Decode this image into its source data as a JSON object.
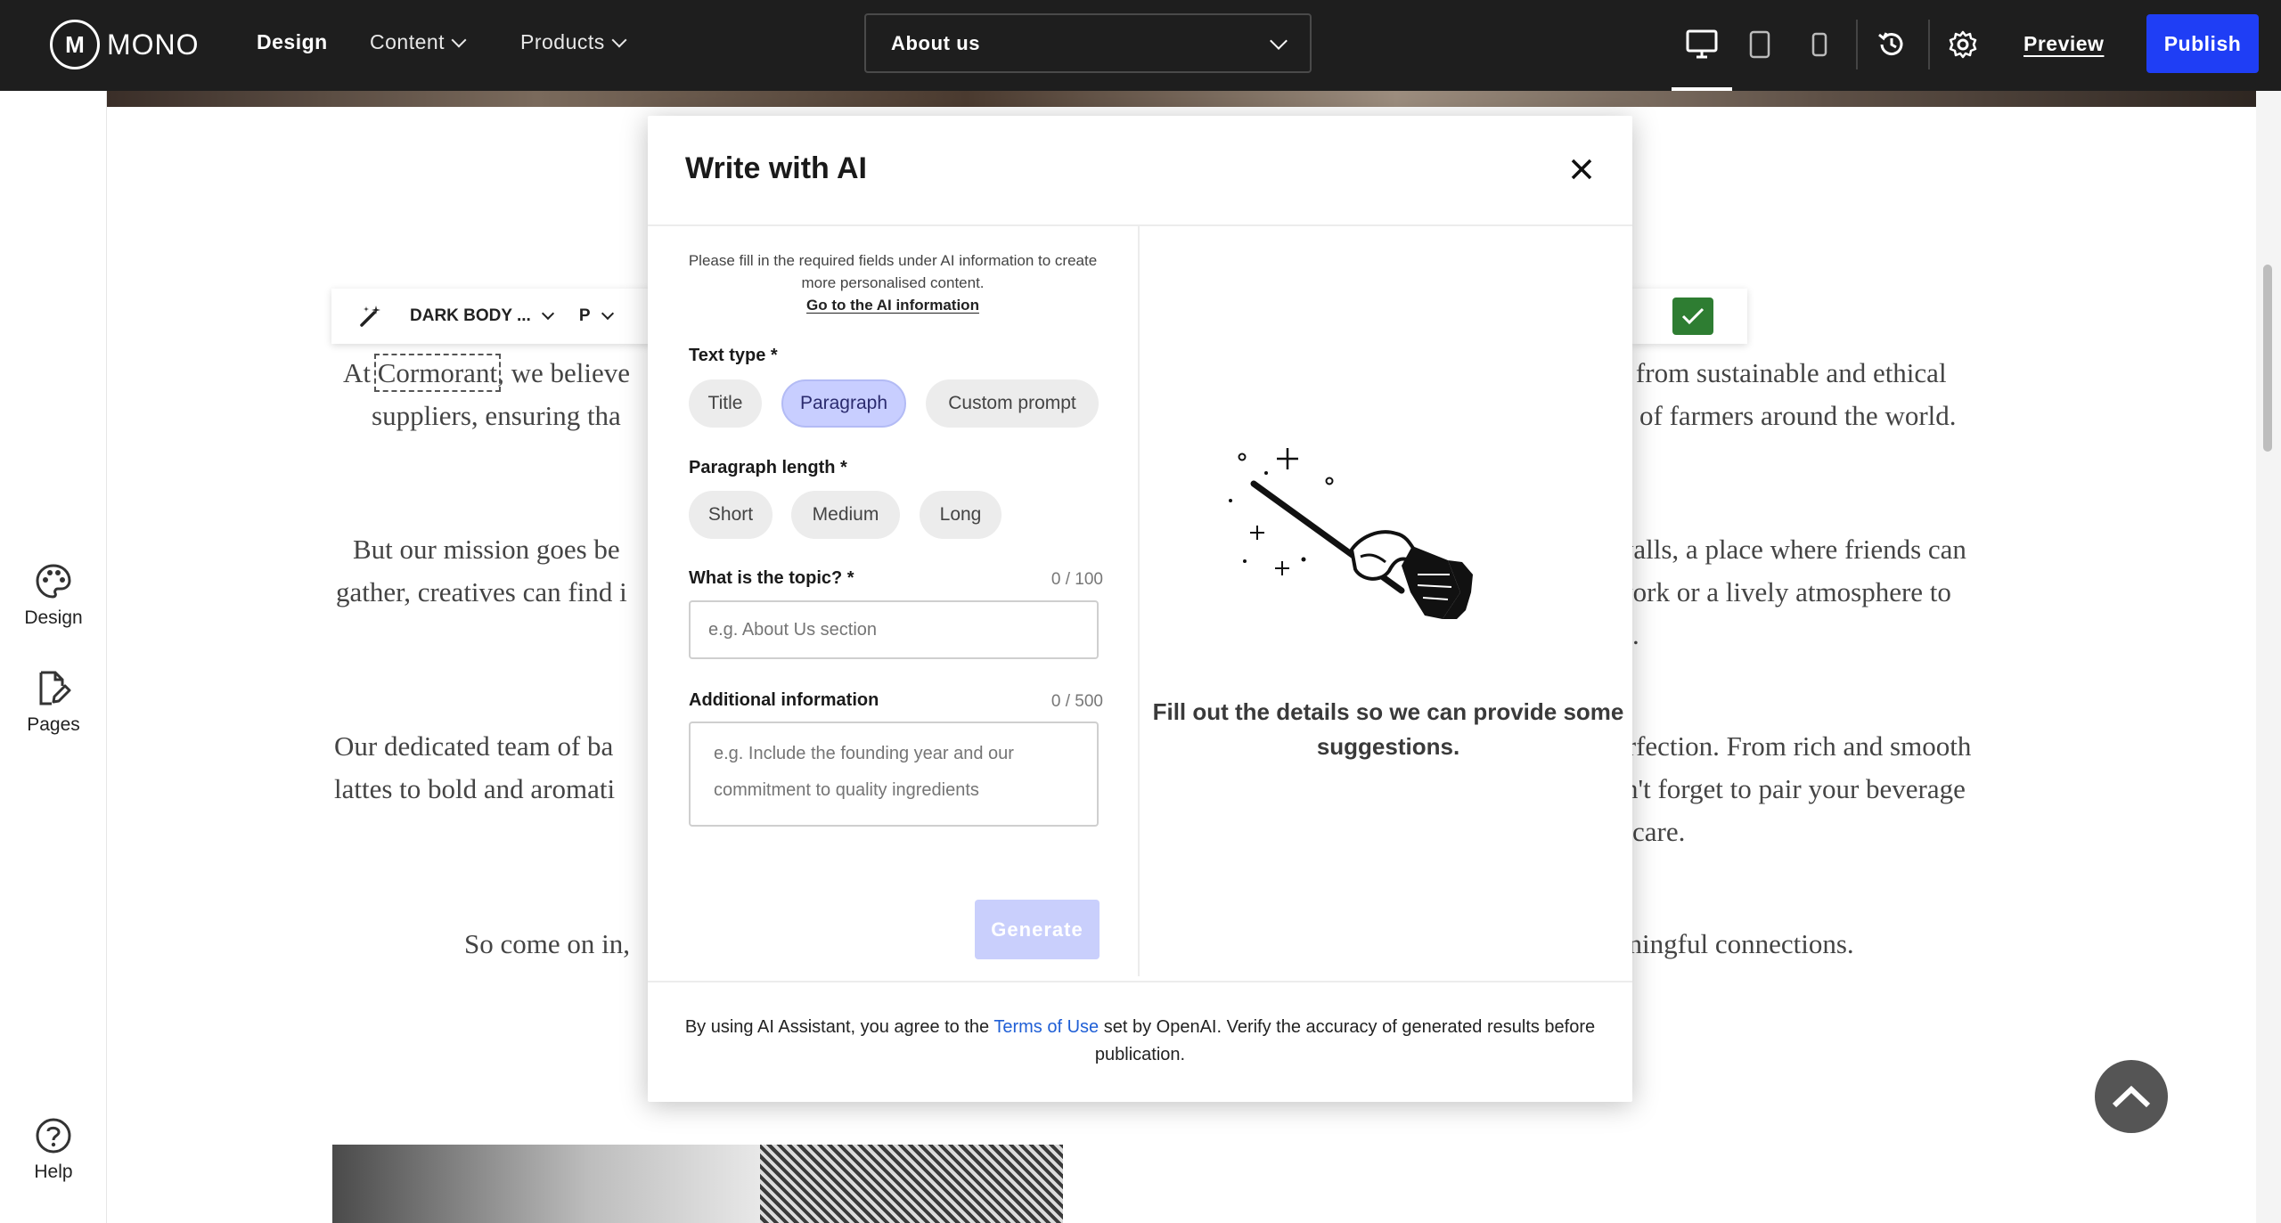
{
  "topbar": {
    "logo_mark": "M",
    "logo_text": "MONO",
    "nav": [
      {
        "label": "Design"
      },
      {
        "label": "Content"
      },
      {
        "label": "Products"
      }
    ],
    "page_select_value": "About us",
    "preview_label": "Preview",
    "publish_label": "Publish"
  },
  "sidebar": {
    "items": [
      {
        "label": "Design",
        "icon": "palette-icon"
      },
      {
        "label": "Pages",
        "icon": "page-edit-icon"
      },
      {
        "label": "Help",
        "icon": "help-icon"
      }
    ]
  },
  "editor_toolbar": {
    "style_label": "DARK BODY ...",
    "tag_label": "P"
  },
  "canvas": {
    "paragraphs": [
      {
        "left": "At ",
        "highlight": "Cormorant",
        "left_rest": ", we believe",
        "right": "nts from sustainable and ethical"
      },
      {
        "left": "suppliers, ensuring tha",
        "right": "of farmers around the world."
      },
      {
        "left": "But our mission goes be",
        "right": "walls, a place where friends can"
      },
      {
        "left": "gather, creatives can find i",
        "right": "o work or a lively atmosphere to"
      },
      {
        "left": "",
        "right": "."
      },
      {
        "left": "Our dedicated team of ba",
        "right": "erfection. From rich and smooth"
      },
      {
        "left": "lattes to bold and aromati",
        "right": "don't forget to pair your beverage"
      },
      {
        "left": "",
        "right": "care."
      },
      {
        "left": "So come on in,",
        "right": "eaningful connections."
      }
    ]
  },
  "modal": {
    "title": "Write with AI",
    "info_note": "Please fill in the required fields under AI information to create more personalised content.",
    "info_link": "Go to the AI information",
    "text_type": {
      "label": "Text type *",
      "options": [
        "Title",
        "Paragraph",
        "Custom prompt"
      ],
      "selected": "Paragraph"
    },
    "paragraph_length": {
      "label": "Paragraph length *",
      "options": [
        "Short",
        "Medium",
        "Long"
      ]
    },
    "topic": {
      "label": "What is the topic? *",
      "counter": "0 / 100",
      "placeholder": "e.g. About Us section"
    },
    "additional": {
      "label": "Additional information",
      "counter": "0 / 500",
      "placeholder": "e.g. Include the founding year and our commitment to quality ingredients"
    },
    "generate_label": "Generate",
    "right_message": "Fill out the details so we can provide some suggestions.",
    "footer": {
      "before": "By using AI Assistant, you agree to the ",
      "link": "Terms of Use",
      "after": " set by OpenAI. Verify the accuracy of generated results before publication."
    }
  },
  "colors": {
    "accent": "#1f3ef5",
    "chip_selected": "#c8ceff",
    "check": "#2e7d32",
    "link": "#1f5fd6"
  }
}
